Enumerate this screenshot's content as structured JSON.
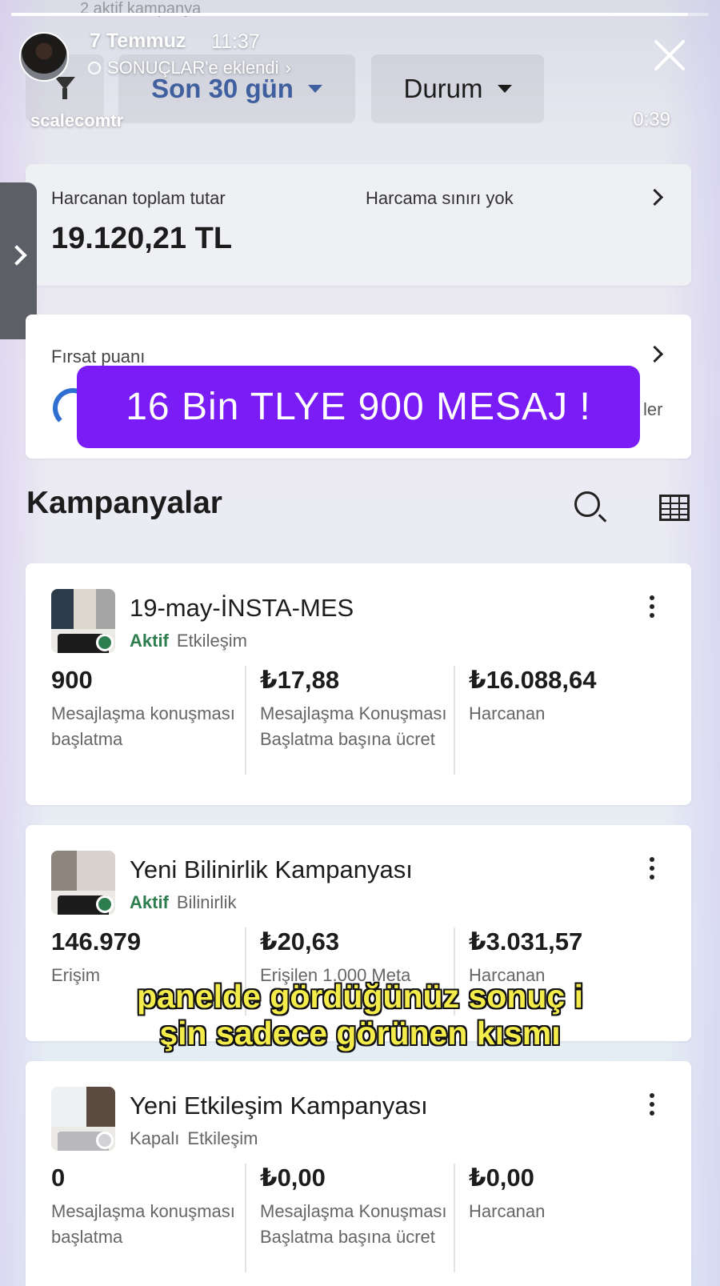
{
  "story": {
    "date": "7 Temmuz",
    "time": "11:37",
    "music": "SONUÇLAR'e eklendi",
    "username": "scalecomtr",
    "duration": "0:39"
  },
  "top_partial": "2 aktif kampanya",
  "filters": {
    "date_range": "Son 30 gün",
    "status": "Durum"
  },
  "spend": {
    "label": "Harcanan toplam tutar",
    "value": "19.120,21 TL",
    "limit": "Harcama sınırı yok"
  },
  "opportunity": {
    "label": "Fırsat puanı",
    "partial_right": "ler"
  },
  "banner": "16 Bin TLYE 900 MESAJ !",
  "campaigns_title": "Kampanyalar",
  "campaigns": [
    {
      "name": "19-may-İNSTA-MES",
      "status": "Aktif",
      "status_color": "#2e7d4f",
      "type": "Etkileşim",
      "metrics": [
        {
          "value": "900",
          "desc": "Mesajlaşma konuşması başlatma"
        },
        {
          "value": "₺17,88",
          "desc": "Mesajlaşma Konuşması Başlatma başına ücret"
        },
        {
          "value": "₺16.088,64",
          "desc": "Harcanan"
        }
      ]
    },
    {
      "name": "Yeni Bilinirlik Kampanyası",
      "status": "Aktif",
      "status_color": "#2e7d4f",
      "type": "Bilinirlik",
      "metrics": [
        {
          "value": "146.979",
          "desc": "Erişim"
        },
        {
          "value": "₺20,63",
          "desc": "Erişilen 1.000 Meta"
        },
        {
          "value": "₺3.031,57",
          "desc": "Harcanan"
        }
      ]
    },
    {
      "name": "Yeni Etkileşim Kampanyası",
      "status": "Kapalı",
      "status_color": "#d2d2d6",
      "type": "Etkileşim",
      "metrics": [
        {
          "value": "0",
          "desc": "Mesajlaşma konuşması başlatma"
        },
        {
          "value": "₺0,00",
          "desc": "Mesajlaşma Konuşması Başlatma başına ücret"
        },
        {
          "value": "₺0,00",
          "desc": "Harcanan"
        }
      ]
    }
  ],
  "caption": [
    "panelde gördüğünüz sonuç i",
    "şin sadece görünen kısmı"
  ],
  "progress_fraction": 0.97
}
